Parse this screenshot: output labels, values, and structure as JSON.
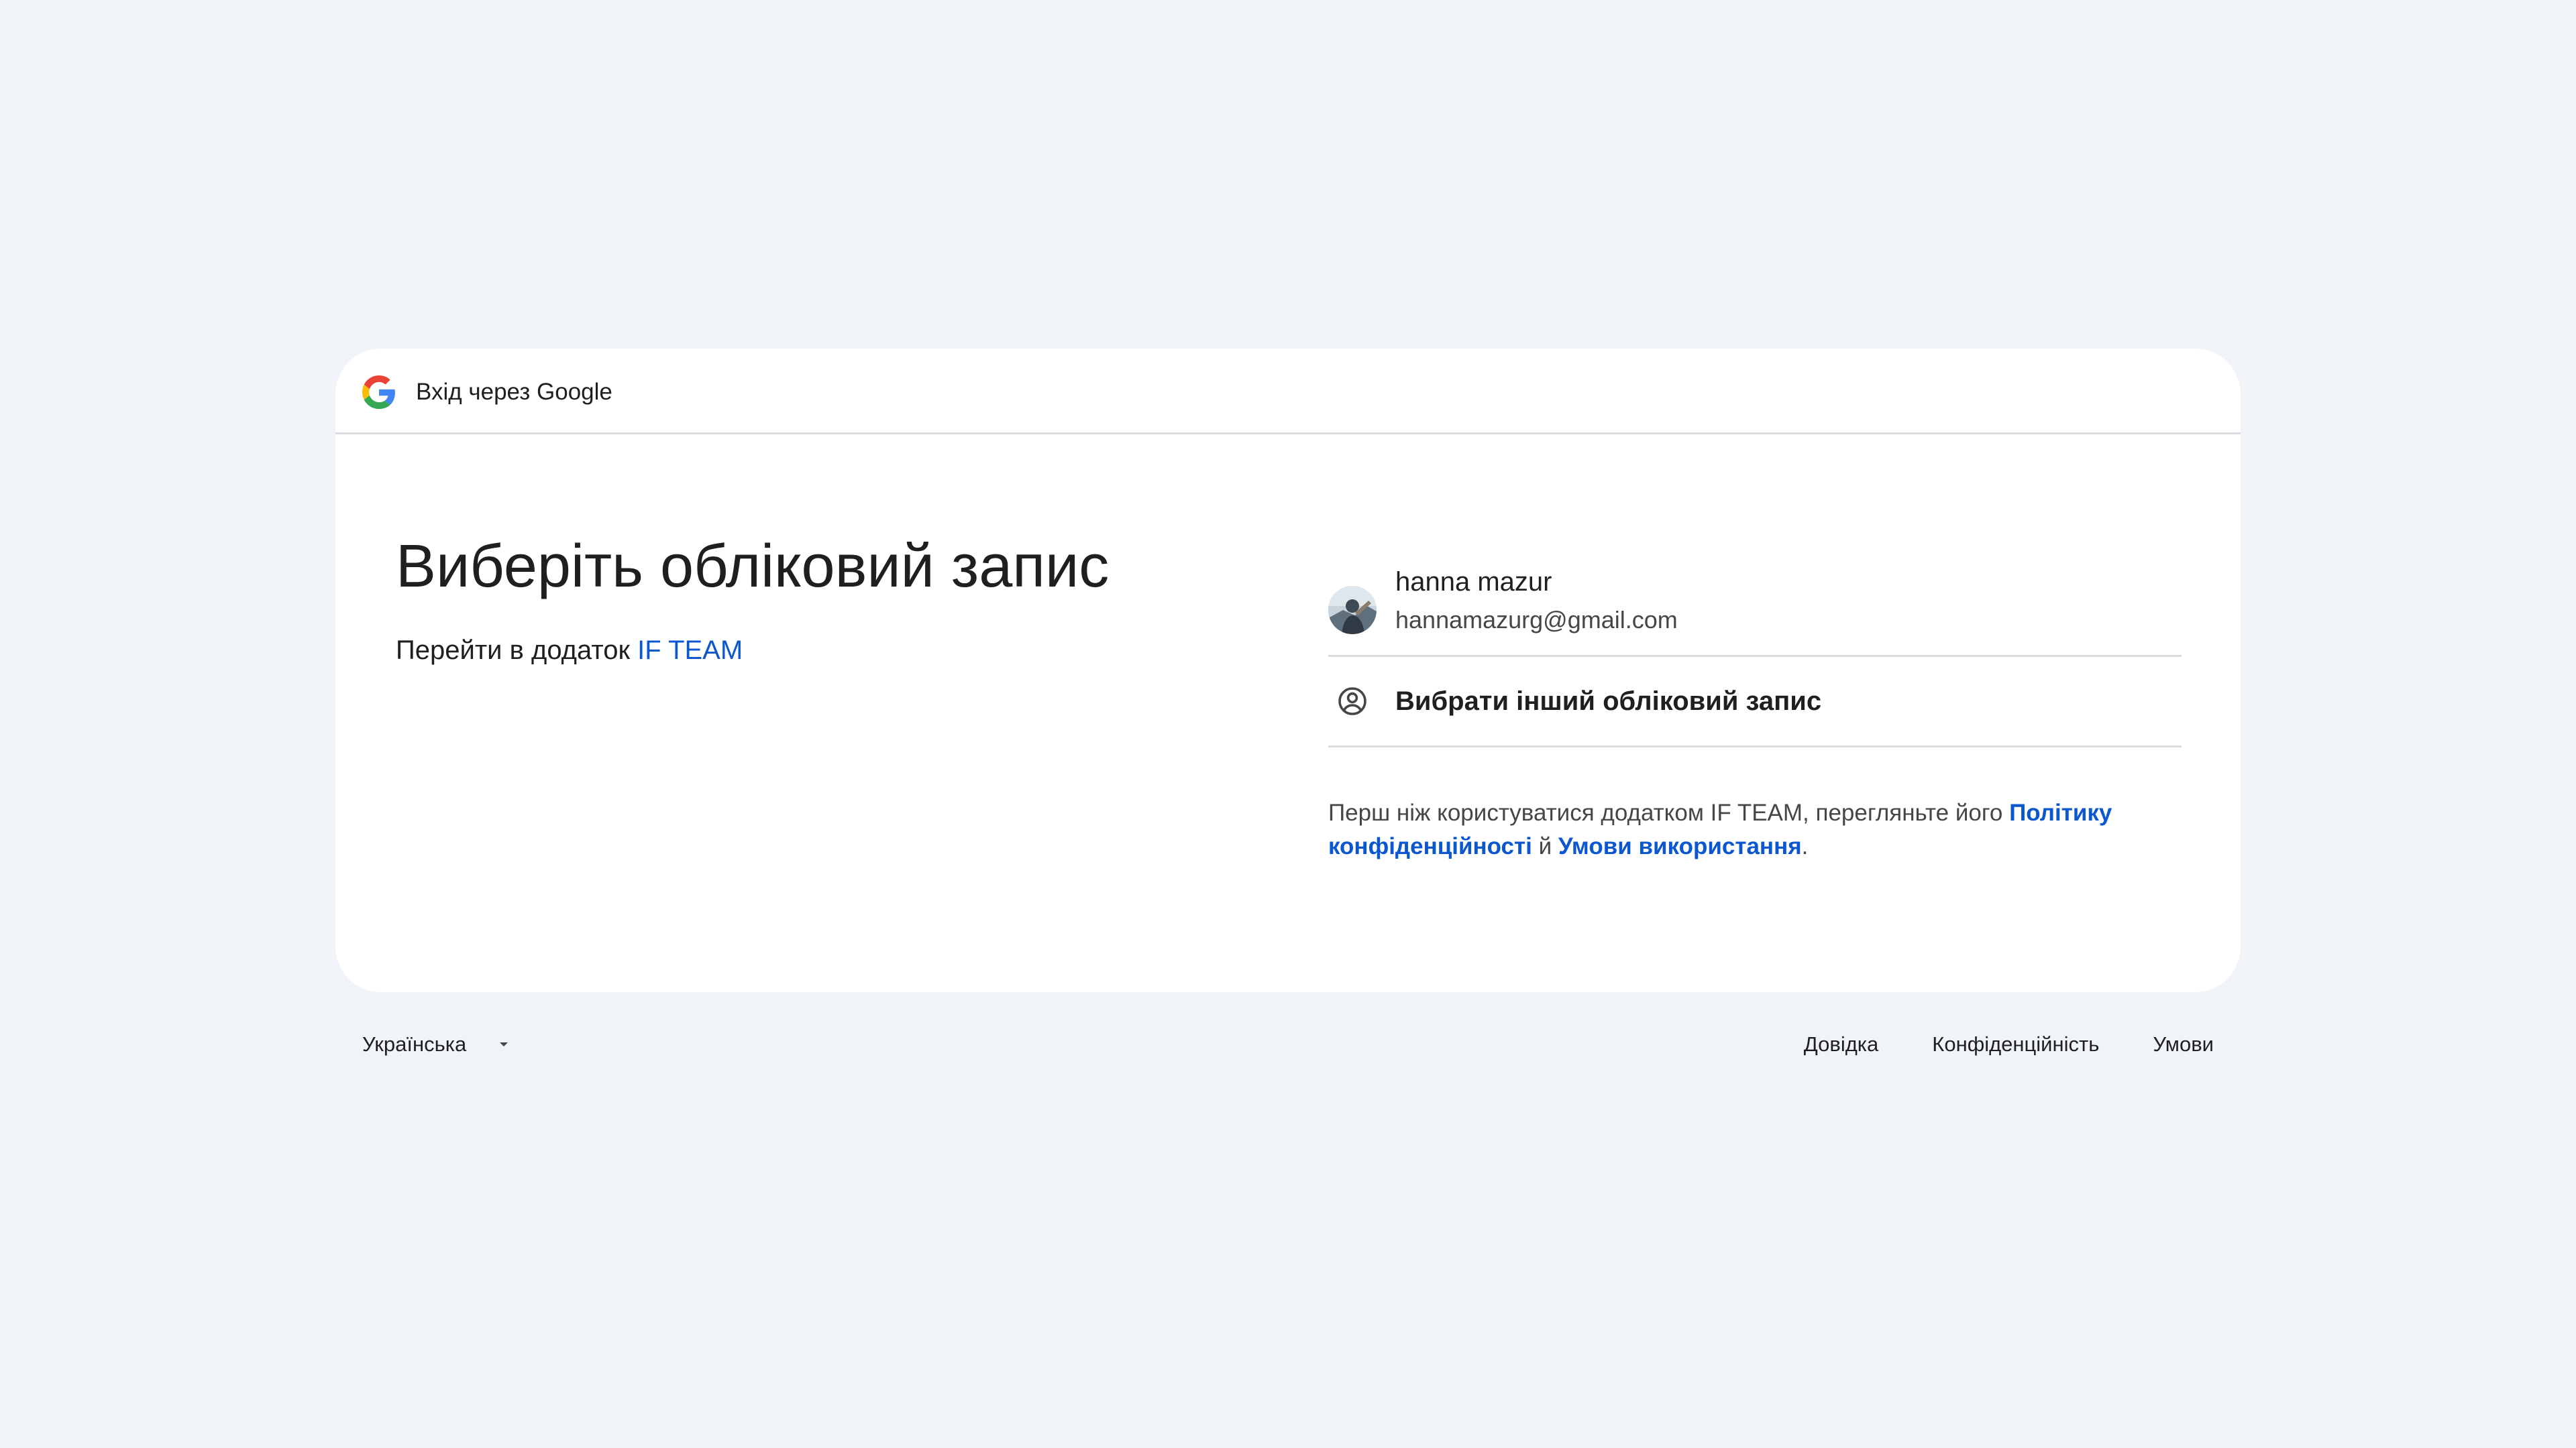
{
  "header": {
    "title": "Вхід через Google"
  },
  "main": {
    "title": "Виберіть обліковий запис",
    "subtitle_prefix": "Перейти в додаток ",
    "app_name": "IF TEAM"
  },
  "accounts": [
    {
      "name": "hanna mazur",
      "email": "hannamazurg@gmail.com"
    }
  ],
  "other_account": {
    "label": "Вибрати інший обліковий запис"
  },
  "disclaimer": {
    "prefix": "Перш ніж користуватися додатком IF TEAM, перегляньте його ",
    "privacy_link": "Політику конфіденційності",
    "conjunction": " й ",
    "terms_link": "Умови використання",
    "suffix": "."
  },
  "footer": {
    "language": "Українська",
    "links": {
      "help": "Довідка",
      "privacy": "Конфіденційність",
      "terms": "Умови"
    }
  },
  "colors": {
    "background": "#f0f4f9",
    "card": "#ffffff",
    "link": "#0b57d0",
    "divider": "#dadce0",
    "text_primary": "#1f1f1f",
    "text_secondary": "#444746"
  },
  "icons": {
    "logo": "google-g-logo",
    "other_account": "account-circle-icon",
    "language_dropdown": "arrow-drop-down-icon"
  }
}
